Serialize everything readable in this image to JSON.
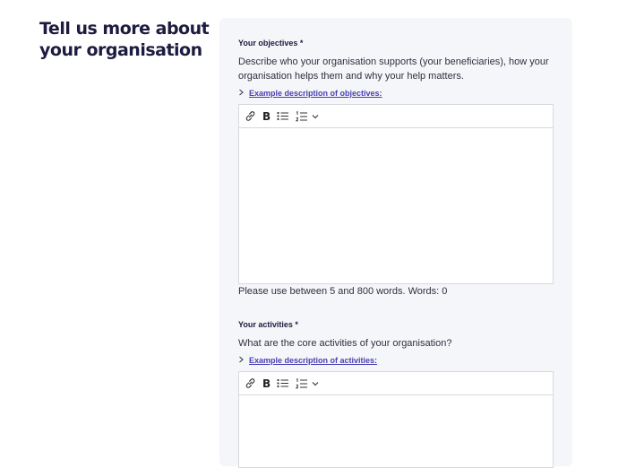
{
  "section": {
    "title": "Tell us more about your organisation"
  },
  "fields": [
    {
      "label": "Your objectives *",
      "description": "Describe who your organisation supports (your beneficiaries), how your organisation helps them and why your help matters.",
      "example_link": "Example description of objectives:",
      "value": "",
      "hint": "Please use between 5 and 800 words. Words: 0"
    },
    {
      "label": "Your activities *",
      "description": "What are the core activities of your organisation?",
      "example_link": "Example description of activities:",
      "value": ""
    }
  ],
  "toolbar": {
    "items": [
      "link-icon",
      "bold-icon",
      "bullet-list-icon",
      "numbered-list-icon",
      "chevron-down-icon"
    ],
    "bold_glyph": "B"
  },
  "colors": {
    "heading": "#1d1b3f",
    "link": "#4a3fb3",
    "panel": "#f5f6f9",
    "border": "#d8d9df"
  }
}
